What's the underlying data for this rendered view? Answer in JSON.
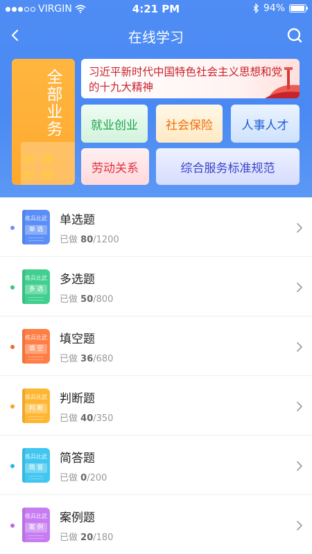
{
  "status_bar": {
    "carrier": "VIRGIN",
    "time": "4:21 PM",
    "battery_text": "94%",
    "battery_level": 0.94
  },
  "nav": {
    "title": "在线学习",
    "back_icon": "chevron-left-icon",
    "search_icon": "search-icon"
  },
  "banner": {
    "all_business": "全部业务",
    "policy_text": "习近平新时代中国特色社会主义思想和党的十九大精神",
    "tiles": {
      "employment": "就业创业",
      "social_insurance": "社会保险",
      "personnel": "人事人才",
      "labor_relations": "劳动关系",
      "service_standards": "综合服务标准规范"
    }
  },
  "list": {
    "done_prefix": "已做",
    "items": [
      {
        "title": "单选题",
        "book_top": "练兵比武",
        "book_label": "单 选",
        "done": "80",
        "total": "/1200",
        "color": "#5b8ef7",
        "dot": "#7b8df2"
      },
      {
        "title": "多选题",
        "book_top": "练兵比武",
        "book_label": "多 选",
        "done": "50",
        "total": "/800",
        "color": "#3fcf8e",
        "dot": "#34c77b"
      },
      {
        "title": "填空题",
        "book_top": "练兵比武",
        "book_label": "填 空",
        "done": "36",
        "total": "/680",
        "color": "#ff7e45",
        "dot": "#f06b2c"
      },
      {
        "title": "判断题",
        "book_top": "练兵比武",
        "book_label": "判 断",
        "done": "40",
        "total": "/350",
        "color": "#ffb733",
        "dot": "#f5a623"
      },
      {
        "title": "简答题",
        "book_top": "练兵比武",
        "book_label": "简 答",
        "done": "0",
        "total": "/200",
        "color": "#40c6f0",
        "dot": "#2bb8e6"
      },
      {
        "title": "案例题",
        "book_top": "练兵比武",
        "book_label": "案 例",
        "done": "20",
        "total": "/180",
        "color": "#c77cf2",
        "dot": "#b66be8"
      }
    ]
  }
}
